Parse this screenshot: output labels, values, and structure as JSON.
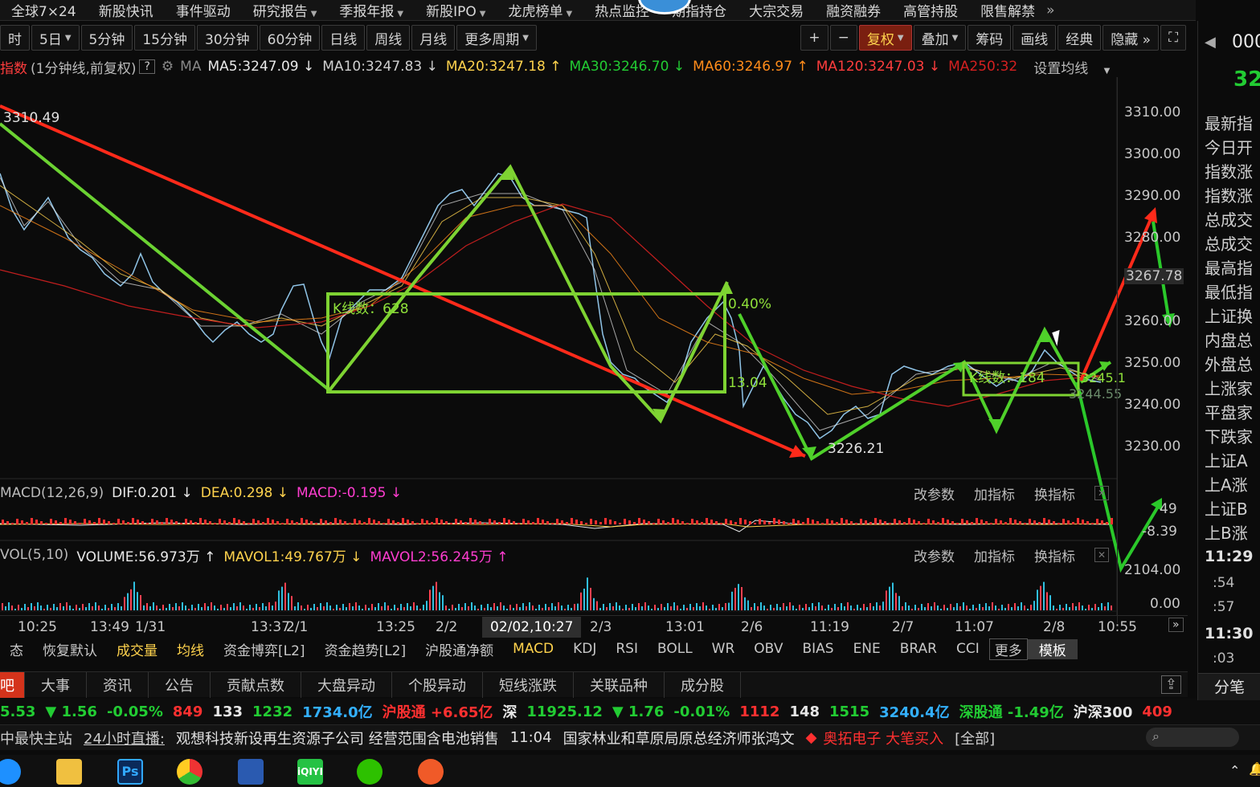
{
  "topnav": {
    "items": [
      {
        "label": "全球7×24",
        "caret": false
      },
      {
        "label": "新股快讯",
        "caret": false
      },
      {
        "label": "事件驱动",
        "caret": false
      },
      {
        "label": "研究报告",
        "caret": true
      },
      {
        "label": "季报年报",
        "caret": true
      },
      {
        "label": "新股IPO",
        "caret": true
      },
      {
        "label": "龙虎榜单",
        "caret": true
      },
      {
        "label": "热点监控",
        "caret": false
      },
      {
        "label": "期指持仓",
        "caret": false
      },
      {
        "label": "大宗交易",
        "caret": false
      },
      {
        "label": "融资融券",
        "caret": false
      },
      {
        "label": "高管持股",
        "caret": false
      },
      {
        "label": "限售解禁",
        "caret": false
      }
    ],
    "more": "»"
  },
  "periodbar": {
    "left": [
      {
        "label": "时",
        "caret": false
      },
      {
        "label": "5日",
        "caret": true
      },
      {
        "label": "5分钟",
        "caret": false
      },
      {
        "label": "15分钟",
        "caret": false
      },
      {
        "label": "30分钟",
        "caret": false
      },
      {
        "label": "60分钟",
        "caret": false
      },
      {
        "label": "日线",
        "caret": false
      },
      {
        "label": "周线",
        "caret": false
      },
      {
        "label": "月线",
        "caret": false
      },
      {
        "label": "更多周期",
        "caret": true
      }
    ],
    "right": [
      {
        "label": "+",
        "caret": false,
        "active": false
      },
      {
        "label": "−",
        "caret": false,
        "active": false
      },
      {
        "label": "复权",
        "caret": true,
        "active": true
      },
      {
        "label": "叠加",
        "caret": true,
        "active": false
      },
      {
        "label": "筹码",
        "caret": false,
        "active": false
      },
      {
        "label": "画线",
        "caret": false,
        "active": false
      },
      {
        "label": "经典",
        "caret": false,
        "active": false
      },
      {
        "label": "隐藏 »",
        "caret": false,
        "active": false
      },
      {
        "label": "⛶",
        "caret": false,
        "active": false
      }
    ]
  },
  "maline": {
    "name": "指数",
    "desc": "(1分钟线,前复权)",
    "help": "?",
    "ma_label": "MA",
    "items": [
      {
        "text": "MA5:3247.09 ↓",
        "color": "#e8e8e8"
      },
      {
        "text": "MA10:3247.83 ↓",
        "color": "#d0d0d0"
      },
      {
        "text": "MA20:3247.18 ↑",
        "color": "#ffd34d"
      },
      {
        "text": "MA30:3246.70 ↓",
        "color": "#22cc33"
      },
      {
        "text": "MA60:3246.97 ↑",
        "color": "#ff8c1a"
      },
      {
        "text": "MA120:3247.03 ↓",
        "color": "#ff3d3d"
      },
      {
        "text": "MA250:32",
        "color": "#d42020"
      }
    ],
    "settings": "设置均线"
  },
  "price_axis": [
    "3310.00",
    "3300.00",
    "3290.00",
    "3280.00",
    "3267.78",
    "3260.00",
    "3250.00",
    "3240.00",
    "3230.00"
  ],
  "annotations": {
    "high_label": "3310.49",
    "low_label": "3226.21",
    "box1_label": "K线数：628",
    "pct_label": "0.40%",
    "mid_label": "13.04",
    "box2_label": "K线数：184",
    "box2_val1": "3244.55",
    "box2_val2": "3245.1"
  },
  "macd": {
    "name": "MACD(12,26,9)",
    "dif": "DIF:0.201 ↓",
    "dea": "DEA:0.298 ↓",
    "macd": "MACD:-0.195 ↓",
    "axis_top": "49",
    "axis_bottom": "-8.39",
    "tools": [
      "改参数",
      "加指标",
      "换指标"
    ]
  },
  "vol": {
    "name": "VOL(5,10)",
    "volume": "VOLUME:56.973万 ↑",
    "mavol1": "MAVOL1:49.767万 ↓",
    "mavol2": "MAVOL2:56.245万 ↑",
    "axis_top": "2104.00",
    "axis_bottom": "0.00",
    "tools": [
      "改参数",
      "加指标",
      "换指标"
    ]
  },
  "xaxis": {
    "labels": [
      "10:25",
      "13:49",
      "1/31",
      "13:37",
      "2/1",
      "13:25",
      "2/2",
      "02/02,10:27",
      "2/3",
      "13:01",
      "2/6",
      "11:19",
      "2/7",
      "11:07",
      "2/8",
      "10:55"
    ],
    "more": "»"
  },
  "indtabs": {
    "items": [
      {
        "label": "态",
        "style": ""
      },
      {
        "label": "恢复默认",
        "style": ""
      },
      {
        "label": "成交量",
        "style": "gold"
      },
      {
        "label": "均线",
        "style": "gold"
      },
      {
        "label": "资金博弈[L2]",
        "style": ""
      },
      {
        "label": "资金趋势[L2]",
        "style": ""
      },
      {
        "label": "沪股通净额",
        "style": ""
      },
      {
        "label": "MACD",
        "style": "gold"
      },
      {
        "label": "KDJ",
        "style": ""
      },
      {
        "label": "RSI",
        "style": ""
      },
      {
        "label": "BOLL",
        "style": ""
      },
      {
        "label": "WR",
        "style": ""
      },
      {
        "label": "OBV",
        "style": ""
      },
      {
        "label": "BIAS",
        "style": ""
      },
      {
        "label": "ENE",
        "style": ""
      },
      {
        "label": "BRAR",
        "style": ""
      },
      {
        "label": "CCI",
        "style": ""
      },
      {
        "label": "更多",
        "style": "boxed"
      },
      {
        "label": "模板",
        "style": "moban"
      }
    ]
  },
  "infotabs": {
    "items": [
      "吧",
      "大事",
      "资讯",
      "公告",
      "贡献点数",
      "大盘异动",
      "个股异动",
      "短线涨跌",
      "关联品种",
      "成分股"
    ]
  },
  "market": {
    "items": [
      {
        "text": "5.53",
        "cls": "g"
      },
      {
        "text": "▼ 1.56",
        "cls": "g"
      },
      {
        "text": "-0.05%",
        "cls": "g"
      },
      {
        "text": "849",
        "cls": "r"
      },
      {
        "text": "133",
        "cls": "w"
      },
      {
        "text": "1232",
        "cls": "g"
      },
      {
        "text": "1734.0亿",
        "cls": "c"
      },
      {
        "text": "沪股通 +6.65亿",
        "cls": "r"
      },
      {
        "text": "深",
        "cls": "w"
      },
      {
        "text": "11925.12",
        "cls": "g"
      },
      {
        "text": "▼ 1.76",
        "cls": "g"
      },
      {
        "text": "-0.01%",
        "cls": "g"
      },
      {
        "text": "1112",
        "cls": "r"
      },
      {
        "text": "148",
        "cls": "w"
      },
      {
        "text": "1515",
        "cls": "g"
      },
      {
        "text": "3240.4亿",
        "cls": "c"
      },
      {
        "text": "深股通 -1.49亿",
        "cls": "g"
      },
      {
        "text": "沪深300",
        "cls": "w"
      },
      {
        "text": "409",
        "cls": "r"
      }
    ]
  },
  "news": {
    "source": "中最快主站",
    "live": "24小时直播:",
    "headline1": "观想科技新设再生资源子公司 经营范围含电池销售",
    "time": "11:04",
    "headline2": "国家林业和草原局原总经济师张鸿文",
    "alert": "奥拓电子 大笔买入",
    "all": "[全部]"
  },
  "rightpanel": {
    "code": "000",
    "price": "32",
    "labels": [
      "最新指",
      "今日开",
      "指数涨",
      "指数涨",
      "总成交",
      "总成交",
      "最高指",
      "最低指",
      "上证换",
      "内盘总",
      "外盘总",
      "上涨家",
      "平盘家",
      "下跌家",
      "上证A",
      "上A涨",
      "上证B",
      "上B涨"
    ],
    "time1": "11:29",
    "secs1": [
      ":54",
      ":57"
    ],
    "time2": "11:30",
    "secs2": [
      ":03"
    ],
    "tab": "分笔"
  }
}
